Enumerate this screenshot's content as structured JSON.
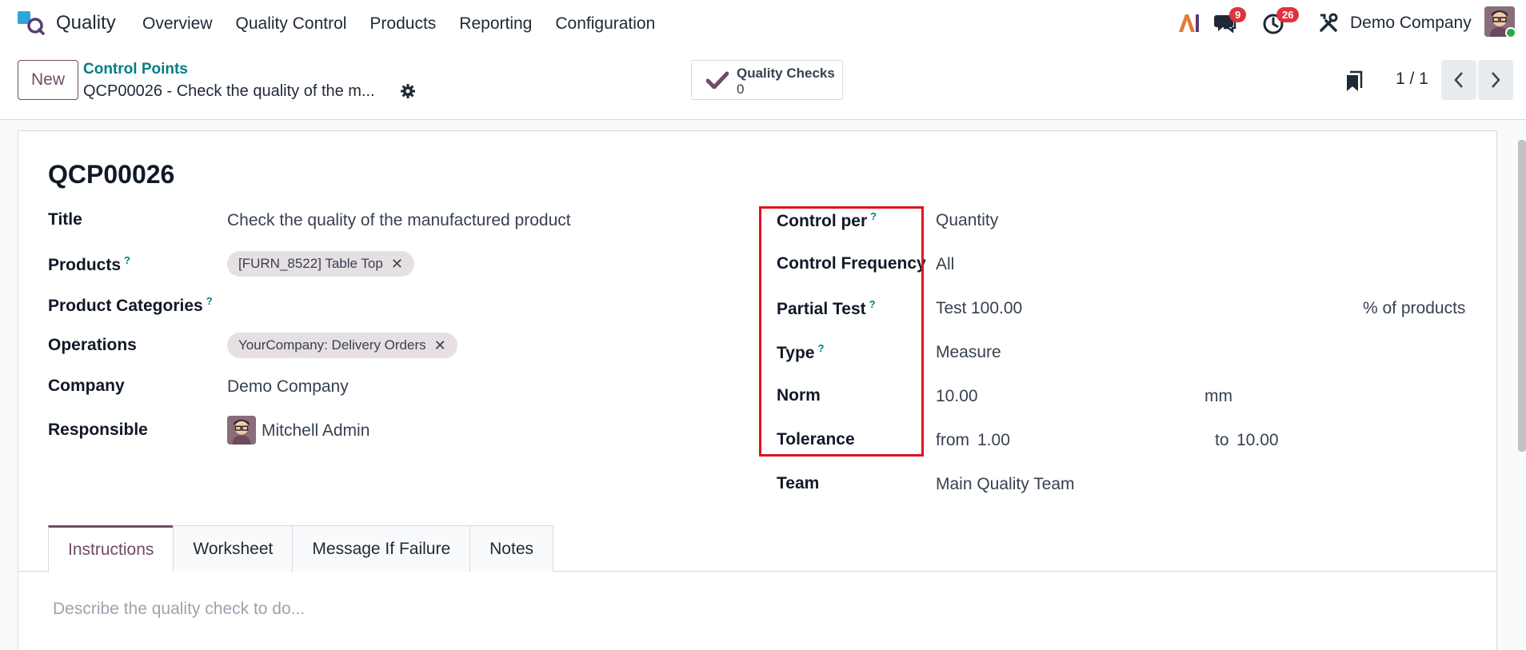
{
  "navbar": {
    "app_name": "Quality",
    "menu": [
      "Overview",
      "Quality Control",
      "Products",
      "Reporting",
      "Configuration"
    ],
    "ai_label": "AI",
    "chat_count": "9",
    "activity_count": "26",
    "company": "Demo Company"
  },
  "control_panel": {
    "new_label": "New",
    "breadcrumb_parent": "Control Points",
    "breadcrumb_current": "QCP00026 - Check the quality of the m...",
    "smart_button_label": "Quality Checks",
    "smart_button_value": "0",
    "pager": "1 / 1"
  },
  "record": {
    "name": "QCP00026",
    "left_fields": {
      "title_label": "Title",
      "title_value": "Check the quality of the manufactured product",
      "products_label": "Products",
      "products_tag": "[FURN_8522] Table Top",
      "categories_label": "Product Categories",
      "operations_label": "Operations",
      "operations_tag": "YourCompany: Delivery Orders",
      "company_label": "Company",
      "company_value": "Demo Company",
      "responsible_label": "Responsible",
      "responsible_value": "Mitchell Admin"
    },
    "right_fields": {
      "control_per_label": "Control per",
      "control_per_value": "Quantity",
      "frequency_label": "Control Frequency",
      "frequency_value": "All",
      "partial_label": "Partial Test",
      "partial_prefix": "Test",
      "partial_value": "100.00",
      "partial_suffix": "% of products",
      "type_label": "Type",
      "type_value": "Measure",
      "norm_label": "Norm",
      "norm_value": "10.00",
      "norm_unit": "mm",
      "tolerance_label": "Tolerance",
      "tolerance_from_label": "from",
      "tolerance_from": "1.00",
      "tolerance_to_label": "to",
      "tolerance_to": "10.00",
      "team_label": "Team",
      "team_value": "Main Quality Team"
    }
  },
  "tabs": [
    "Instructions",
    "Worksheet",
    "Message If Failure",
    "Notes"
  ],
  "instructions_placeholder": "Describe the quality check to do...",
  "colors": {
    "brand": "#714b67",
    "link": "#017e84",
    "highlight": "#e0141e",
    "badge": "#e0323e"
  }
}
